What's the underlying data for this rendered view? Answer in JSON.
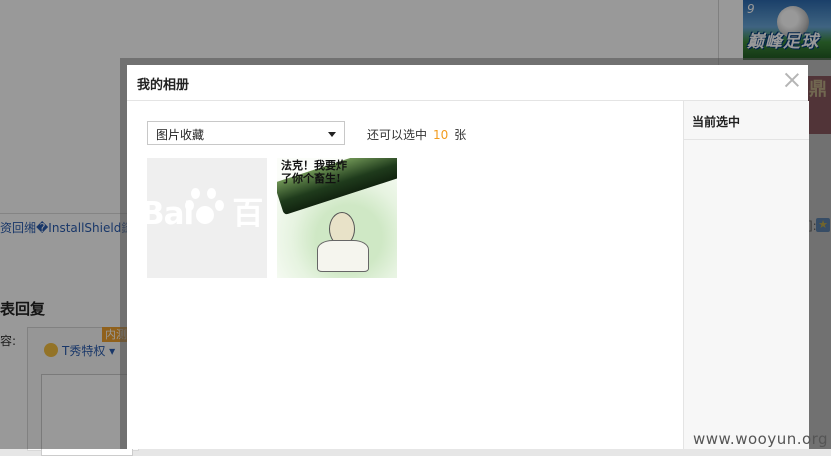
{
  "background": {
    "thumb_number": "9",
    "thumb_title": "巅峰足球",
    "thumb2_text": "鼎",
    "link_text": "资回缃�InstallShield鐩伴暚鍝",
    "right_label": "]:",
    "reply_heading": "表回复",
    "content_label": "容:",
    "tshow_label": "T秀特权",
    "badge_text": "内测"
  },
  "dialog": {
    "title": "我的相册",
    "album_select": {
      "value": "图片收藏"
    },
    "remaining": {
      "prefix": "还可以选中",
      "count": "10",
      "suffix": "张"
    },
    "photos": [
      {
        "caption": ""
      },
      {
        "caption_line1": "法克！我要炸",
        "caption_line2": "了你个畜生!"
      }
    ],
    "side_panel": {
      "title": "当前选中"
    }
  },
  "watermark": "www.wooyun.org",
  "colors": {
    "accent_count": "#f29c1f",
    "link": "#2a5db0"
  }
}
